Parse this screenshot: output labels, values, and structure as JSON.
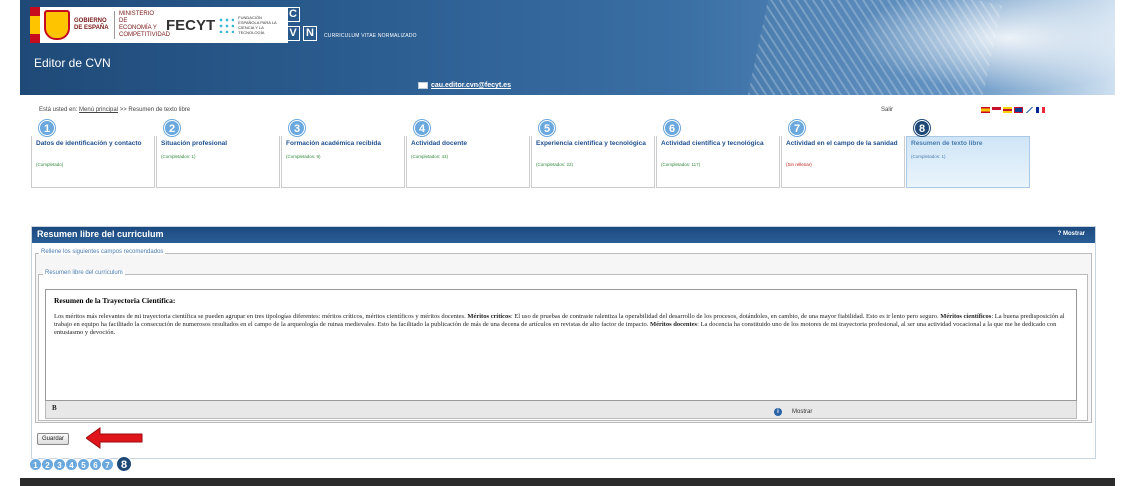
{
  "header": {
    "logo_gob": "GOBIERNO DE ESPAÑA",
    "logo_ministerio": "MINISTERIO DE ECONOMÍA Y COMPETITIVIDAD",
    "logo_fecyt": "FECYT",
    "logo_fecyt_sub": "FUNDACIÓN ESPAÑOLA PARA LA CIENCIA Y LA TECNOLOGÍA",
    "cvn_letters": [
      "C",
      "V",
      "N"
    ],
    "cvn_text": "CURRICULUM VITAE NORMALIZADO",
    "app_title": "Editor de CVN",
    "email": "cau.editor.cvn@fecyt.es"
  },
  "breadcrumb": {
    "prefix": "Está usted en:",
    "link": "Menú principal",
    "separator": ">>",
    "current": "Resumen de texto libre",
    "logout": "Salir"
  },
  "steps": [
    {
      "num": "1",
      "title": "Datos de identificación y contacto",
      "status": "(Completado)"
    },
    {
      "num": "2",
      "title": "Situación profesional",
      "status": "(Completados: 1)"
    },
    {
      "num": "3",
      "title": "Formación académica recibida",
      "status": "(Completados: 9)"
    },
    {
      "num": "4",
      "title": "Actividad docente",
      "status": "(Completados: 43)"
    },
    {
      "num": "5",
      "title": "Experiencia científica y tecnológica",
      "status": "(Completados: 22)"
    },
    {
      "num": "6",
      "title": "Actividad científica y tecnológica",
      "status": "(Completados: 117)"
    },
    {
      "num": "7",
      "title": "Actividad en el campo de la sanidad",
      "status": "(Sin rellenar)"
    },
    {
      "num": "8",
      "title": "Resumen de texto libre",
      "status": "(Completados: 1)"
    }
  ],
  "panel": {
    "title": "Resumen libre del curriculum",
    "show_label": "Mostrar",
    "outer_legend": "Rellene los siguientes campos recomendados",
    "inner_legend": "Resumen libre del curriculum",
    "editor_heading": "Resumen de la Trayectoria Científica:",
    "p1": "Los méritos más relevantes de mi trayectoria científica se pueden agrupar en tres tipologías diferentes: méritos críticos, méritos científicos y méritos docentes. ",
    "b1": "Méritos críticos",
    "p2": ": El uso de pruebas de contraste ralentiza la operabilidad del desarrollo de los procesos, dotándoles, en cambio, de una mayor fiabilidad. Esto es ir lento pero seguro. ",
    "b2": "Méritos científicos",
    "p3": ": La buena predisposición al trabajo en equipo ha facilitado la consecución de numerosos resultados en el campo de la arqueología de ruinas medievales. Esto ha facilitado la publicación de más de una decena de artículos en revistas de alto factor de impacto. ",
    "b3": "Méritos docentes",
    "p4": ": La docencia ha constituido uno de los motores de mi trayectoria profesional, al ser una actividad vocacional a la que me he dedicado con entusiasmo y devoción.",
    "bold_button": "B",
    "toolbar_show": "Mostrar",
    "save_button": "Guardar"
  },
  "bottom_steps": [
    "1",
    "2",
    "3",
    "4",
    "5",
    "6",
    "7",
    "8"
  ],
  "colors": {
    "header_dark": "#1f4a78",
    "step_circle": "#6ba8de",
    "arrow": "#e0141b"
  }
}
